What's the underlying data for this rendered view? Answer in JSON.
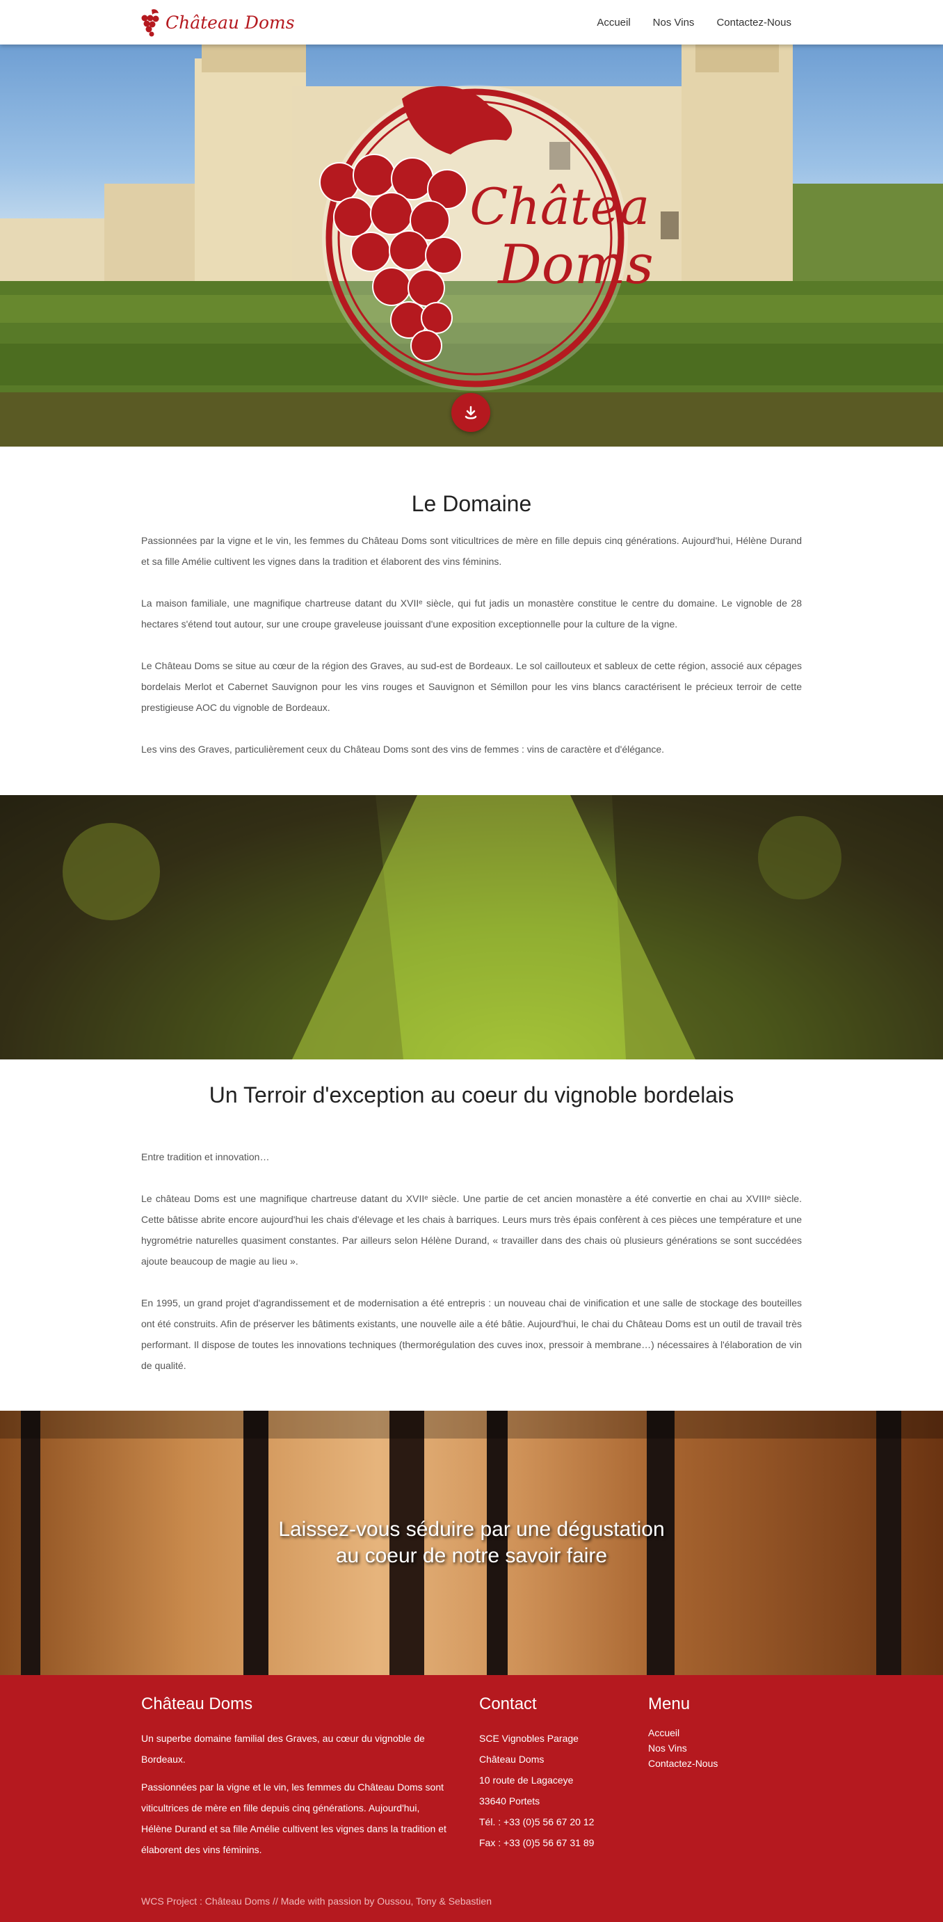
{
  "nav": {
    "brand": "Château Doms",
    "links": [
      "Accueil",
      "Nos Vins",
      "Contactez-Nous"
    ]
  },
  "hero": {
    "logo_line1": "Château",
    "logo_line2": "Doms"
  },
  "domaine": {
    "title": "Le Domaine",
    "paragraphs": [
      "Passionnées par la vigne et le vin, les femmes du Château Doms sont viticultrices de mère en fille depuis cinq générations. Aujourd'hui, Hélène Durand et sa fille Amélie cultivent les vignes dans la tradition et élaborent des vins féminins.",
      "La maison familiale, une magnifique chartreuse datant du XVIIᵉ siècle, qui fut jadis un monastère constitue le centre du domaine. Le vignoble de 28 hectares s'étend tout autour, sur une croupe graveleuse jouissant d'une exposition exceptionnelle pour la culture de la vigne.",
      "Le Château Doms se situe au cœur de la région des Graves, au sud-est de Bordeaux. Le sol caillouteux et sableux de cette région, associé aux cépages bordelais Merlot et Cabernet Sauvignon pour les vins rouges et Sauvignon et Sémillon pour les vins blancs caractérisent le précieux terroir de cette prestigieuse AOC du vignoble de Bordeaux.",
      "Les vins des Graves, particulièrement ceux du Château Doms sont des vins de femmes : vins de caractère et d'élégance."
    ]
  },
  "terroir": {
    "title": "Un Terroir d'exception au coeur du vignoble bordelais",
    "paragraphs": [
      "Entre tradition et innovation…",
      "Le château Doms est une magnifique chartreuse datant du XVIIᵉ siècle. Une partie de cet ancien monastère a été convertie en chai au XVIIIᵉ siècle. Cette bâtisse abrite encore aujourd'hui les chais d'élevage et les chais à barriques. Leurs murs très épais confèrent à ces pièces une température et une hygrométrie naturelles quasiment constantes. Par ailleurs selon Hélène Durand, « travailler dans des chais où plusieurs générations se sont succédées ajoute beaucoup de magie au lieu ».",
      "En 1995, un grand projet d'agrandissement et de modernisation a été entrepris : un nouveau chai de vinification et une salle de stockage des bouteilles ont été construits. Afin de préserver les bâtiments existants, une nouvelle aile a été bâtie. Aujourd'hui, le chai du Château Doms est un outil de travail très performant. Il dispose de toutes les innovations techniques (thermorégulation des cuves inox, pressoir à membrane…) nécessaires à l'élaboration de vin de qualité."
    ]
  },
  "barrels": {
    "line1": "Laissez-vous séduire par une dégustation",
    "line2": "au coeur de notre savoir faire"
  },
  "footer": {
    "about": {
      "title": "Château Doms",
      "paragraphs": [
        "Un superbe domaine familial des Graves, au cœur du vignoble de Bordeaux.",
        "Passionnées par la vigne et le vin, les femmes du Château Doms sont viticultrices de mère en fille depuis cinq générations. Aujourd'hui, Hélène Durand et sa fille Amélie cultivent les vignes dans la tradition et élaborent des vins féminins."
      ]
    },
    "contact": {
      "title": "Contact",
      "lines": [
        "SCE Vignobles Parage",
        "Château Doms",
        "10 route de Lagaceye",
        "33640 Portets",
        "Tél. : +33 (0)5 56 67 20 12",
        "Fax : +33 (0)5 56 67 31 89"
      ]
    },
    "menu": {
      "title": "Menu",
      "links": [
        "Accueil",
        "Nos Vins",
        "Contactez-Nous"
      ]
    },
    "credits": "WCS Project : Château Doms // Made with passion by Oussou, Tony & Sebastien"
  },
  "colors": {
    "brand_red": "#b5191f",
    "text": "#555555",
    "heading": "#222222"
  }
}
